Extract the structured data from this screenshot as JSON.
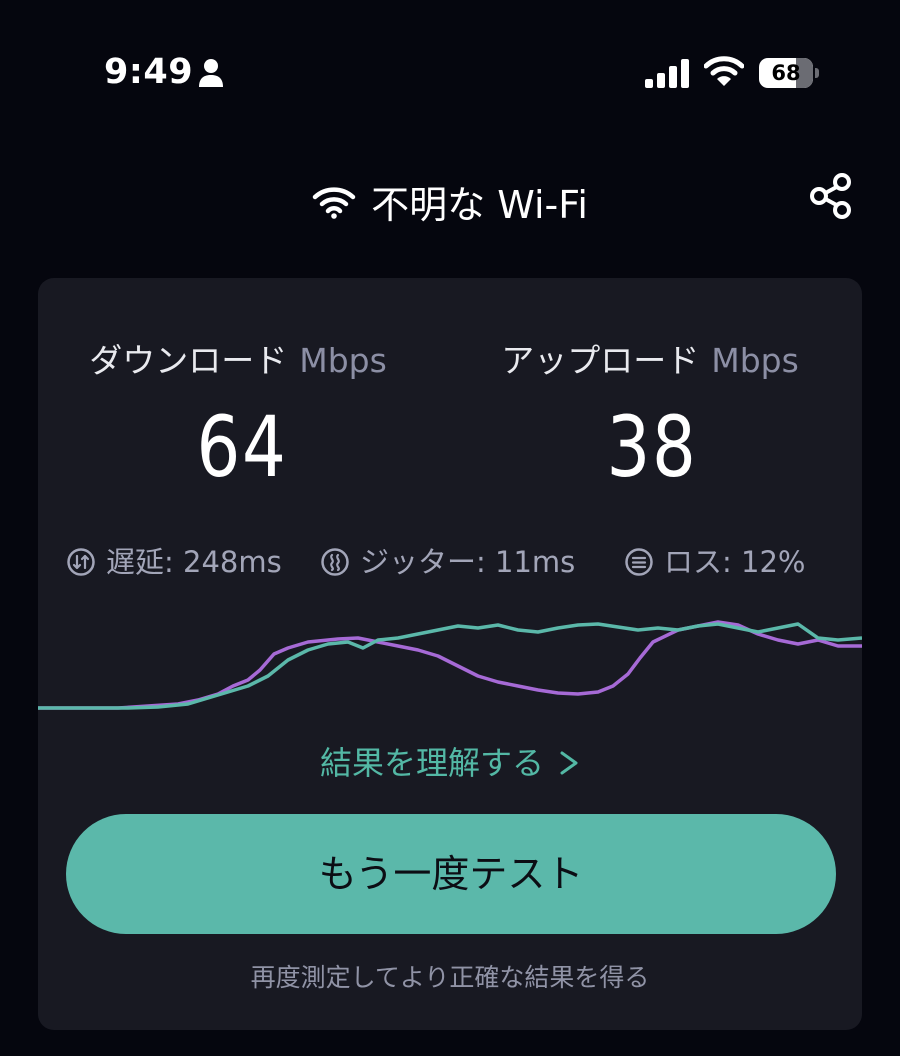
{
  "status_bar": {
    "time": "9:49",
    "battery_level": "68",
    "icons": [
      "person-icon",
      "cellular-signal-icon",
      "wifi-icon",
      "battery-icon"
    ]
  },
  "header": {
    "network_name": "不明な Wi-Fi",
    "icons": [
      "wifi-icon",
      "share-icon"
    ]
  },
  "results": {
    "download": {
      "label": "ダウンロード",
      "unit": "Mbps",
      "value": "64"
    },
    "upload": {
      "label": "アップロード",
      "unit": "Mbps",
      "value": "38"
    },
    "stats": {
      "latency": "遅延: 248ms",
      "jitter": "ジッター: 11ms",
      "loss": "ロス: 12%"
    },
    "graph_colors": {
      "download": "#5bb8aa",
      "upload": "#a66ad6"
    },
    "understand_link": "結果を理解する",
    "retest_button": "もう一度テスト",
    "hint": "再度測定してより正確な結果を得る"
  },
  "colors": {
    "background": "#05060e",
    "card": "#181922",
    "accent": "#5bb8aa",
    "upload_line": "#a66ad6"
  }
}
